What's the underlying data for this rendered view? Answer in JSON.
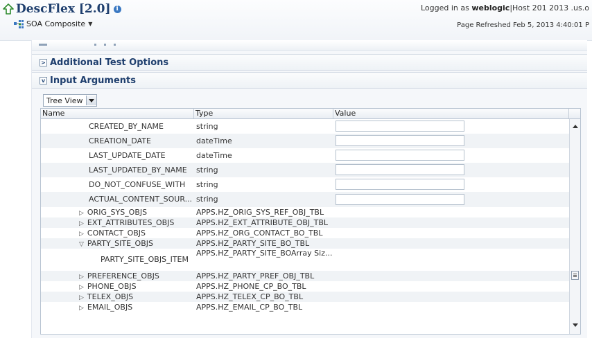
{
  "header": {
    "title": "DescFlex [2.0]",
    "info_glyph": "i",
    "composite_label": "SOA Composite",
    "login_prefix": "Logged in as ",
    "user": "weblogic",
    "host_text": "|Host 201 2013 .us.o",
    "refreshed": "Page Refreshed Feb 5, 2013 4:40:01 P"
  },
  "sections": {
    "additional": {
      "title": "Additional Test Options",
      "glyph": ">"
    },
    "input": {
      "title": "Input Arguments",
      "glyph": "v"
    }
  },
  "tree_view_label": "Tree View",
  "table": {
    "columns": {
      "name": "Name",
      "type": "Type",
      "value": "Value"
    },
    "rows": [
      {
        "name": "CREATED_BY_NAME",
        "type": "string",
        "has_value_field": true
      },
      {
        "name": "CREATION_DATE",
        "type": "dateTime",
        "has_value_field": true
      },
      {
        "name": "LAST_UPDATE_DATE",
        "type": "dateTime",
        "has_value_field": true
      },
      {
        "name": "LAST_UPDATED_BY_NAME",
        "type": "string",
        "has_value_field": true
      },
      {
        "name": "DO_NOT_CONFUSE_WITH",
        "type": "string",
        "has_value_field": true
      },
      {
        "name": "ACTUAL_CONTENT_SOUR...",
        "type": "string",
        "has_value_field": true
      },
      {
        "name": "ORIG_SYS_OBJS",
        "type": "APPS.HZ_ORIG_SYS_REF_OBJ_TBL",
        "expander": "▷"
      },
      {
        "name": "EXT_ATTRIBUTES_OBJS",
        "type": "APPS.HZ_EXT_ATTRIBUTE_OBJ_TBL",
        "expander": "▷"
      },
      {
        "name": "CONTACT_OBJS",
        "type": "APPS.HZ_ORG_CONTACT_BO_TBL",
        "expander": "▷"
      },
      {
        "name": "PARTY_SITE_OBJS",
        "type": "APPS.HZ_PARTY_SITE_BO_TBL",
        "expander": "▽"
      },
      {
        "name": "PARTY_SITE_OBJS_ITEM",
        "type": "APPS.HZ_PARTY_SITE_BOArray Siz..."
      },
      {
        "name": "PREFERENCE_OBJS",
        "type": "APPS.HZ_PARTY_PREF_OBJ_TBL",
        "expander": "▷"
      },
      {
        "name": "PHONE_OBJS",
        "type": "APPS.HZ_PHONE_CP_BO_TBL",
        "expander": "▷"
      },
      {
        "name": "TELEX_OBJS",
        "type": "APPS.HZ_TELEX_CP_BO_TBL",
        "expander": "▷"
      },
      {
        "name": "EMAIL_OBJS",
        "type": "APPS.HZ_EMAIL_CP_BO_TBL",
        "expander": "▷"
      }
    ]
  },
  "icons": {
    "home": "home-arrow-icon",
    "info": "info-icon",
    "composite": "soa-composite-icon",
    "dropdown": "chevron-down-icon"
  },
  "colors": {
    "title": "#1f3f6e",
    "info": "#3a78c2",
    "home": "#2e8b2e"
  }
}
